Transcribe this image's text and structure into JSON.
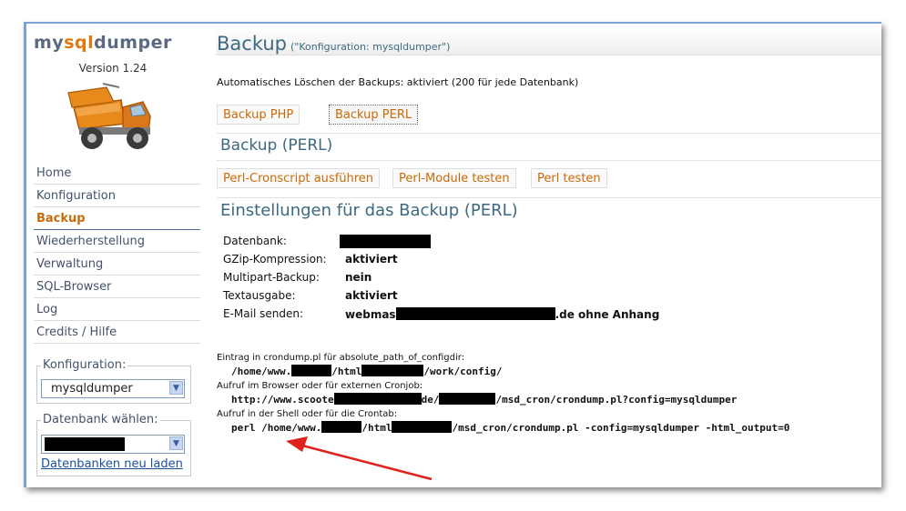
{
  "app": {
    "logo_part1": "my",
    "logo_part2": "sql",
    "logo_part3": "dumper",
    "version": "Version 1.24"
  },
  "sidebar": {
    "nav": [
      {
        "label": "Home",
        "active": false
      },
      {
        "label": "Konfiguration",
        "active": false
      },
      {
        "label": "Backup",
        "active": true
      },
      {
        "label": "Wiederherstellung",
        "active": false
      },
      {
        "label": "Verwaltung",
        "active": false
      },
      {
        "label": "SQL-Browser",
        "active": false
      },
      {
        "label": "Log",
        "active": false
      },
      {
        "label": "Credits / Hilfe",
        "active": false
      }
    ],
    "config_legend": "Konfiguration:",
    "config_value": "mysqldumper",
    "db_legend": "Datenbank wählen:",
    "reload_link": "Datenbanken neu laden"
  },
  "main": {
    "title": "Backup",
    "title_sub": "(\"Konfiguration: mysqldumper\")",
    "auto_delete": "Automatisches Löschen der Backups: aktiviert (200 für jede Datenbank)",
    "buttons": {
      "backup_php": "Backup PHP",
      "backup_perl": "Backup PERL"
    },
    "perl_heading": "Backup (PERL)",
    "perl_buttons": {
      "cronscript": "Perl-Cronscript ausführen",
      "modules": "Perl-Module testen",
      "test": "Perl testen"
    },
    "settings_heading": "Einstellungen für das Backup (PERL)",
    "settings": {
      "db_label": "Datenbank:",
      "gzip_label": "GZip-Kompression:",
      "gzip_value": "aktiviert",
      "multipart_label": "Multipart-Backup:",
      "multipart_value": "nein",
      "text_label": "Textausgabe:",
      "text_value": "aktiviert",
      "email_label": "E-Mail senden:",
      "email_value_prefix": "webmas",
      "email_value_suffix": ".de ohne Anhang"
    },
    "cron": {
      "label1": "Eintrag in crondump.pl für absolute_path_of_configdir:",
      "path1_a": "/home/www.",
      "path1_b": "/html",
      "path1_c": "/work/config/",
      "label2": "Aufruf im Browser oder für externen Cronjob:",
      "path2_a": "http://www.scoote",
      "path2_b": "de/",
      "path2_c": "/msd_cron/crondump.pl?config=mysqldumper",
      "label3": "Aufruf in der Shell oder für die Crontab:",
      "path3_a": "perl /home/www.",
      "path3_b": "/html",
      "path3_c": "/msd_cron/crondump.pl -config=mysqldumper -html_output=0"
    }
  },
  "colors": {
    "accent_orange": "#c96a08",
    "heading_teal": "#3c6a82",
    "annotation_arrow": "#e0201a"
  }
}
